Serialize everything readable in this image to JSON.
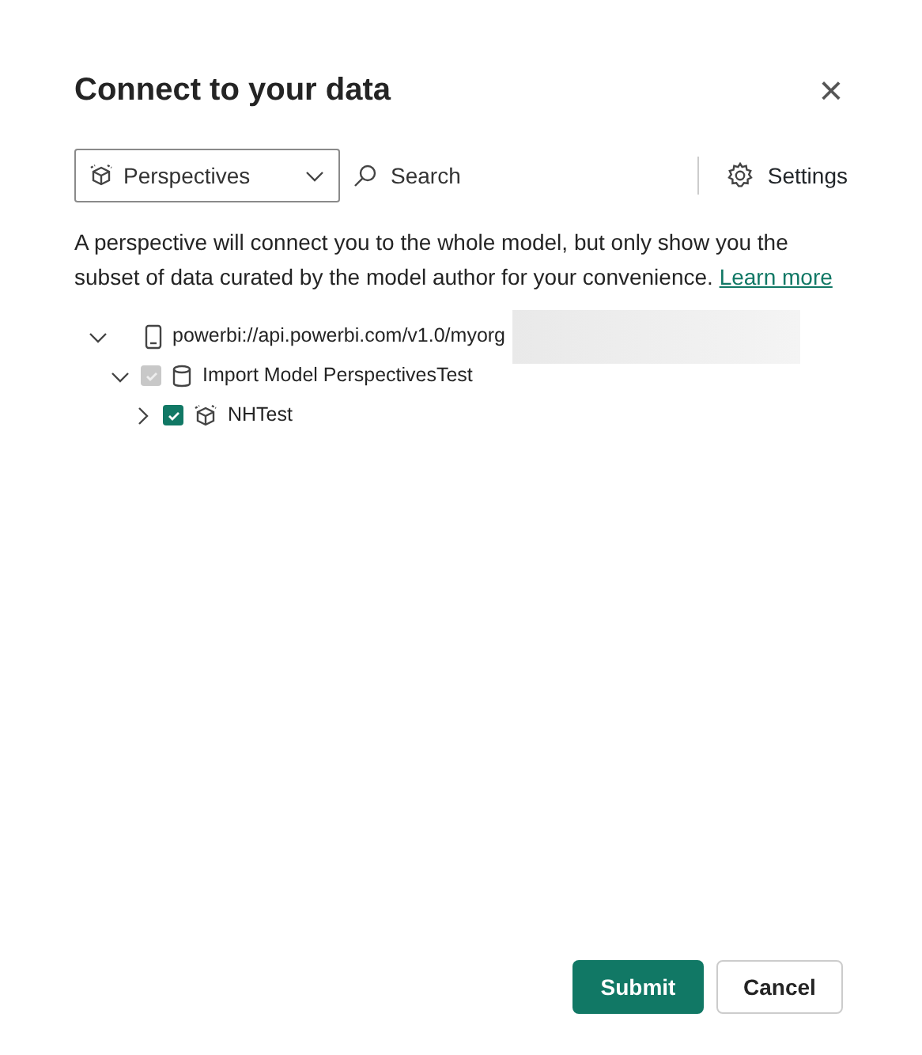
{
  "dialog": {
    "title": "Connect to your data",
    "close": "×"
  },
  "toolbar": {
    "dropdown": {
      "value": "Perspectives"
    },
    "search": {
      "placeholder": "Search"
    },
    "settings": "Settings"
  },
  "description": {
    "text": "A perspective will connect you to the whole model, but only show you the subset of data curated by the model author for your convenience.",
    "link": "Learn more"
  },
  "tree": [
    {
      "label": "powerbi://api.powerbi.com/v1.0/myorg",
      "kind": "server",
      "expanded": true,
      "redacted": true,
      "children": [
        {
          "label": "Import Model PerspectivesTest",
          "kind": "model",
          "expanded": true,
          "checked": true,
          "disabled": true,
          "children": [
            {
              "label": "NHTest",
              "kind": "perspective",
              "expanded": false,
              "checked": true,
              "disabled": false
            }
          ]
        }
      ]
    }
  ],
  "buttons": [
    {
      "label": "Submit",
      "kind": "primary"
    },
    {
      "label": "Cancel",
      "kind": "secondary"
    }
  ]
}
